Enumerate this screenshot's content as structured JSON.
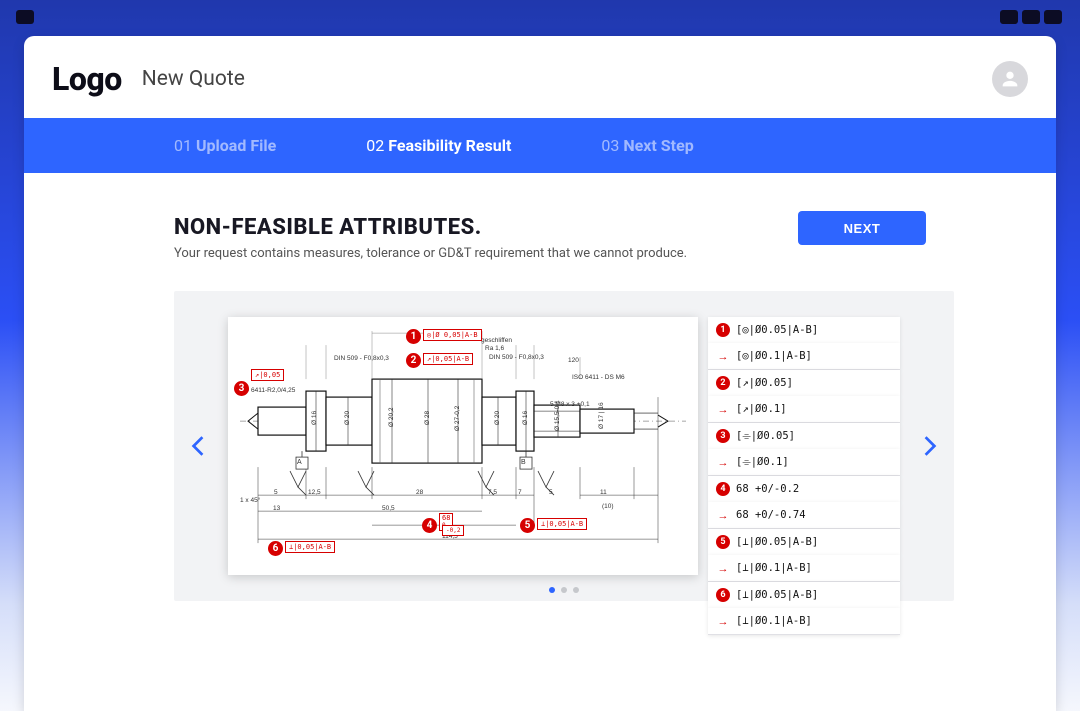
{
  "header": {
    "logo": "Logo",
    "page_title": "New Quote"
  },
  "steps": [
    {
      "num": "01",
      "label": "Upload File",
      "active": false
    },
    {
      "num": "02",
      "label": "Feasibility Result",
      "active": true
    },
    {
      "num": "03",
      "label": "Next Step",
      "active": false
    }
  ],
  "heading": "NON-FEASIBLE ATTRIBUTES.",
  "subtext": "Your request contains measures, tolerance or GD&T requirement that we cannot produce.",
  "next_label": "NEXT",
  "drawing": {
    "notes": {
      "geschliffen": "geschliffen",
      "ra": "Ra 1,6",
      "din1": "DIN 509 - F0,8x0,3",
      "din2": "DIN 509 - F0,8x0,3",
      "iso1": "ISO 6411-R2,0/4,25",
      "iso2": "ISO 6411 - DS M6",
      "thread": "5 M8 x 3 +0,1",
      "chamfer": "1 x 45°",
      "label_a": "A",
      "label_b": "B"
    },
    "dims": {
      "d16": "Ø 16",
      "d20a": "Ø 20",
      "d202": "Ø 20,2",
      "d28": "Ø 28",
      "d2702": "Ø 27-0,2",
      "d20b": "Ø 20",
      "d16b": "Ø 16",
      "d15501": "Ø 15,5-0,1",
      "d17_16": "Ø 17 | 16",
      "x5a": "5",
      "x125": "12,5",
      "x28": "28",
      "x75": "7,5",
      "x7": "7",
      "x5b": "5",
      "x11": "11",
      "x120": "120",
      "x101": "(10)",
      "x13": "13",
      "x505": "50,5",
      "x1145": "114,5",
      "w68": "68",
      "t0": "0",
      "t02n": "-0,2"
    },
    "callouts": {
      "c1": "◎|Ø 0,05|A-B",
      "c2": "↗|0,05|A-B",
      "c3": "↗|0,05",
      "c5": "⊥|0,05|A-B",
      "c6": "⊥|0,05|A-B"
    }
  },
  "issues": [
    {
      "n": "1",
      "from": "[◎|Ø0.05|A-B]",
      "to": "[◎|Ø0.1|A-B]"
    },
    {
      "n": "2",
      "from": "[↗|Ø0.05]",
      "to": "[↗|Ø0.1]"
    },
    {
      "n": "3",
      "from": "[⌯|Ø0.05]",
      "to": "[⌯|Ø0.1]"
    },
    {
      "n": "4",
      "from": "68 +0/-0.2",
      "to": "68 +0/-0.74"
    },
    {
      "n": "5",
      "from": "[⊥|Ø0.05|A-B]",
      "to": "[⊥|Ø0.1|A-B]"
    },
    {
      "n": "6",
      "from": "[⊥|Ø0.05|A-B]",
      "to": "[⊥|Ø0.1|A-B]"
    }
  ],
  "carousel": {
    "dot_count": 3,
    "active_dot": 0
  }
}
